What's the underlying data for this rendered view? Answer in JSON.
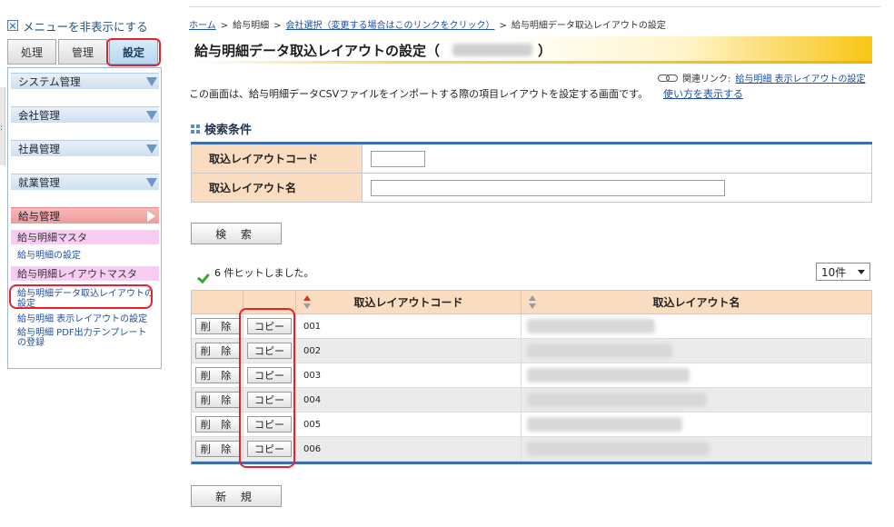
{
  "sidebar": {
    "menu_toggle": "メニューを非表示にする",
    "tabs": [
      "処理",
      "管理",
      "設定"
    ],
    "sections": [
      "システム管理",
      "会社管理",
      "社員管理",
      "就業管理"
    ],
    "pay_section": "給与管理",
    "items": [
      {
        "type": "head",
        "label": "給与明細マスタ"
      },
      {
        "type": "link",
        "label": "給与明細の設定"
      },
      {
        "type": "head",
        "label": "給与明細レイアウトマスタ"
      },
      {
        "type": "link",
        "label": "給与明細データ取込レイアウトの設定"
      },
      {
        "type": "link",
        "label": "給与明細 表示レイアウトの設定"
      },
      {
        "type": "link",
        "label": "給与明細 PDF出力テンプレートの登録"
      }
    ]
  },
  "breadcrumb": {
    "home": "ホーム",
    "pay": "給与明細",
    "company": "会社選択（変更する場合はこのリンクをクリック）",
    "current": "給与明細データ取込レイアウトの設定"
  },
  "page": {
    "title": "給与明細データ取込レイアウトの設定（",
    "title_close": "）",
    "related_label": "関連リンク:",
    "related_link": "給与明細 表示レイアウトの設定",
    "description": "この画面は、給与明細データCSVファイルをインポートする際の項目レイアウトを設定する画面です。",
    "howto": "使い方を表示する"
  },
  "search": {
    "section_title": "検索条件",
    "code_label": "取込レイアウトコード",
    "code_value": "",
    "name_label": "取込レイアウト名",
    "name_value": "",
    "button": "検 索"
  },
  "results": {
    "hit_text": "6 件ヒットしました。",
    "per_page": "10件",
    "col_code": "取込レイアウトコード",
    "col_name": "取込レイアウト名",
    "delete_label": "削 除",
    "copy_label": "コピー",
    "rows": [
      {
        "code": "001",
        "name_fill": 0.37
      },
      {
        "code": "002",
        "name_fill": 0.42
      },
      {
        "code": "003",
        "name_fill": 0.47
      },
      {
        "code": "004",
        "name_fill": 0.52
      },
      {
        "code": "005",
        "name_fill": 0.45
      },
      {
        "code": "006",
        "name_fill": 0.53
      }
    ],
    "new_button": "新 規"
  },
  "colors": {
    "accent": "#3b6eb5",
    "header_bg": "#fadcc1",
    "highlight": "#e8222a",
    "title_gold": "#f2b000"
  }
}
